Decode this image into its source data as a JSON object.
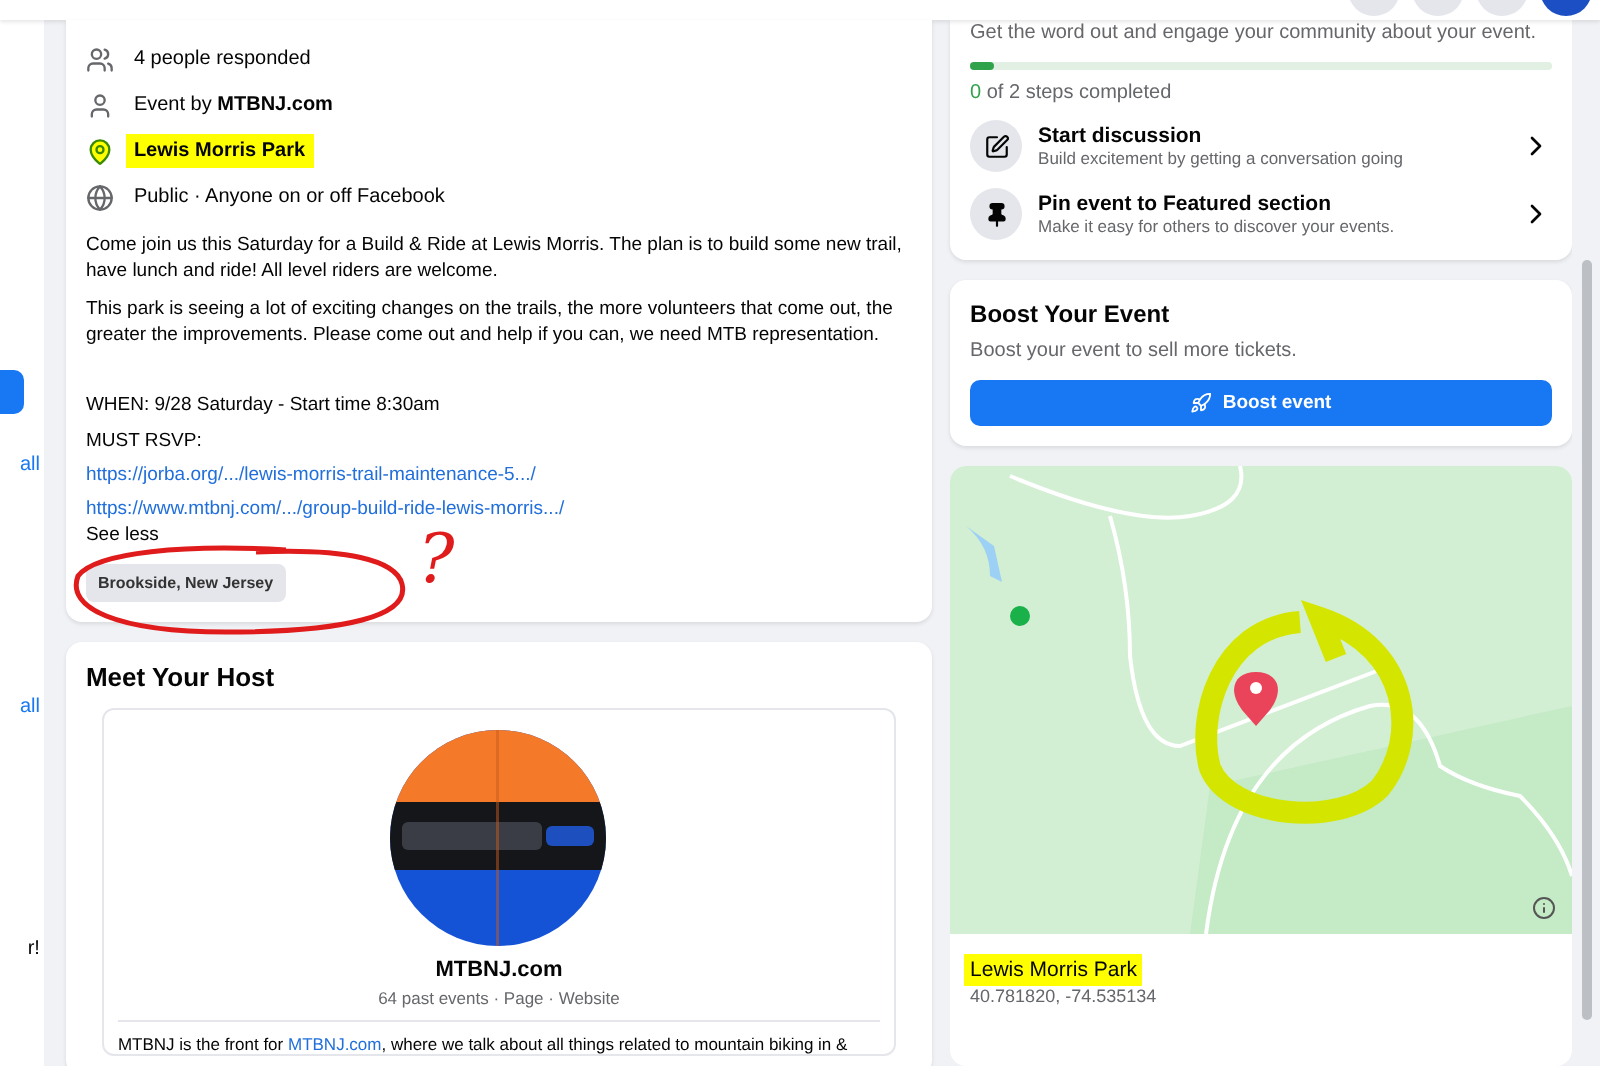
{
  "sidebar": {
    "items": [
      {
        "kind": "button"
      },
      {
        "kind": "link",
        "text": "all"
      },
      {
        "kind": "link",
        "text": "all"
      },
      {
        "kind": "text",
        "text": "r!"
      }
    ]
  },
  "event": {
    "details": [
      {
        "kind": "people",
        "text": "4 people responded",
        "highlighted": false
      },
      {
        "kind": "person",
        "text": "Event by **MTBNJ.com**",
        "highlighted": false
      },
      {
        "kind": "pin",
        "text": "Lewis Morris Park",
        "highlighted": true
      },
      {
        "kind": "globe",
        "text": "Public · Anyone on or off Facebook",
        "highlighted": false
      }
    ],
    "paragraphs": [
      "Come join us this Saturday for a Build & Ride at Lewis Morris. The plan is to build some new trail, have lunch and ride! All level riders are welcome.",
      "This park is seeing a lot of exciting changes on the trails, the more volunteers that come out, the greater the improvements. Please come out and help if you can, we need MTB representation."
    ],
    "when": "WHEN: 9/28 Saturday - Start time 8:30am",
    "rsvp_label": "MUST RSVP:",
    "links": [
      "https://jorba.org/.../lewis-morris-trail-maintenance-5.../",
      "https://www.mtbnj.com/.../group-build-ride-lewis-morris.../"
    ],
    "see_less": "See less",
    "location_tag": "Brookside, New Jersey",
    "annotation": "?"
  },
  "host": {
    "title": "Meet Your Host",
    "name": "MTBNJ.com",
    "meta": "64 past events · Page · Website",
    "about": {
      "before": "MTBNJ is the front for ",
      "link": "MTBNJ.com",
      "after": ", where we talk about all things related to mountain biking in &"
    }
  },
  "promote": {
    "text": "Get the word out and engage your community about your event.",
    "level": 0.04,
    "done": "0",
    "steps": " of 2 steps completed",
    "items": [
      {
        "kind": "edit",
        "title": "Start discussion",
        "subtitle": "Build excitement by getting a conversation going"
      },
      {
        "kind": "pin",
        "title": "Pin event to Featured section",
        "subtitle": "Make it easy for others to discover your events."
      }
    ]
  },
  "boost": {
    "title": "Boost Your Event",
    "text": "Boost your event to sell more tickets.",
    "button": "Boost event"
  },
  "map": {
    "place": "Lewis Morris Park",
    "highlighted": true,
    "coords": "40.781820, -74.535134"
  }
}
